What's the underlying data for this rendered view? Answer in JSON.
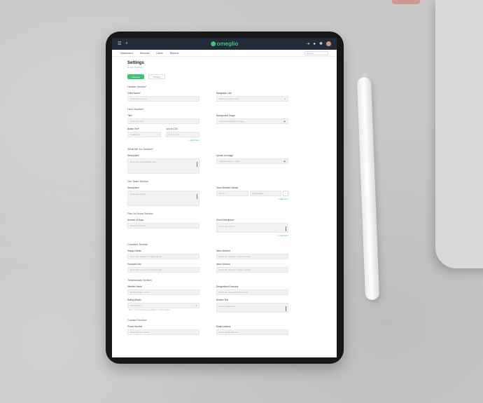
{
  "topbar": {
    "menu_icon": "hamburger-icon",
    "search_icon": "search-icon",
    "logo_text": "omeglio",
    "right_icons": [
      "arrow-icon",
      "bell-icon",
      "gear-icon",
      "avatar"
    ]
  },
  "nav": {
    "items": [
      "Dashboard",
      "Services",
      "Users",
      "Reports"
    ],
    "search_placeholder": "Search..."
  },
  "page": {
    "title": "Settings",
    "breadcrumb": "Home / Settings",
    "tabs": [
      "General",
      "Security"
    ]
  },
  "header_section": {
    "title": "Header Section*",
    "client_name_label": "Client Name*",
    "client_name_placeholder": "Enter client name",
    "navigation_list_label": "Navigation List*",
    "navigation_list_placeholder": "Select an option here"
  },
  "hero_section": {
    "title": "Hero Section*",
    "title_label": "Title*",
    "title_placeholder": "Enter title here",
    "bg_image_label": "Background Image",
    "bg_image_placeholder": "Upload background image",
    "btn_label": "Button Text*",
    "btn_placeholder": "Contact us",
    "cta_label": "Link to CTA",
    "cta_placeholder": "Link to CTA",
    "add_more": "+ Add more"
  },
  "about_section": {
    "title": "What We Do Section*",
    "description_label": "Description*",
    "description_placeholder": "Enter short description here",
    "upload_label": "Upload an image",
    "upload_placeholder": "Upload image or video"
  },
  "team_section": {
    "title": "Our Team Section",
    "description_label": "Description*",
    "description_placeholder": "Enter description",
    "member_label": "Team Member Details",
    "member_placeholder": "Name",
    "member_role": "Designation",
    "add_more": "+ Add more"
  },
  "stats_section": {
    "title": "Plan In Hours Section",
    "days_label": "Number of Days",
    "days_placeholder": "Enter count here",
    "desc_label": "Short Description*",
    "desc_placeholder": "Enter description",
    "add_more": "+ Add more"
  },
  "counter_section": {
    "title": "Counters Section",
    "happy_clients_label": "Happy Clients",
    "happy_clients_placeholder": "Enter the number of happy clients",
    "items_sold_label": "Items Worked",
    "items_sold_placeholder": "Enter the number of items worked",
    "projects_label": "Products Sold",
    "projects_placeholder": "Enter the number of products sold",
    "years_label": "Items Worked",
    "years_placeholder": "Enter the number of years worked"
  },
  "testimonial_section": {
    "title": "Testimonials Section",
    "member_name_label": "Member Name",
    "member_name_placeholder": "Enter member name",
    "designation_label": "Designation/Company",
    "designation_placeholder": "Enter the designation/company",
    "rating_label": "Rating (Stars)",
    "rating_placeholder": "Select rating",
    "rating_hint": "* Note - If no testimonial is available, it will be hidden",
    "review_label": "Review Text",
    "review_placeholder": "Enter review here"
  },
  "contact_section": {
    "title": "Contact Section*",
    "phone_label": "Phone Number",
    "phone_placeholder": "Enter phone number",
    "email_label": "Email Address",
    "email_placeholder": "Enter email address"
  },
  "colors": {
    "accent": "#39c66f",
    "topbar": "#232a3a",
    "tablet_bezel": "#171717"
  }
}
